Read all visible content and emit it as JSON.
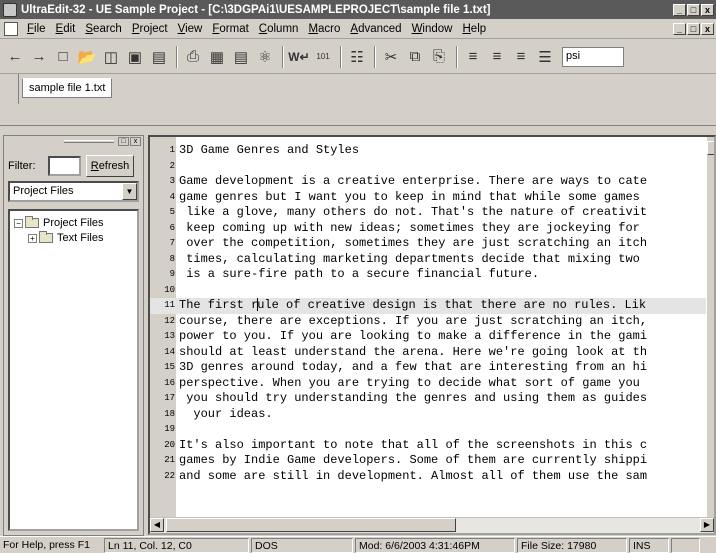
{
  "window": {
    "title": "UltraEdit-32 - UE Sample Project - [C:\\3DGPAi1\\UESAMPLEPROJECT\\sample file 1.txt]",
    "min_label": "_",
    "max_label": "□",
    "close_label": "x"
  },
  "menu": {
    "items": [
      "File",
      "Edit",
      "Search",
      "Project",
      "View",
      "Format",
      "Column",
      "Macro",
      "Advanced",
      "Window",
      "Help"
    ]
  },
  "toolbar": {
    "icons": [
      "back-arrow-icon",
      "forward-arrow-icon",
      "new-file-icon",
      "open-folder-icon",
      "open-file-icon",
      "save-icon",
      "save-all-icon",
      "print-icon",
      "print-preview-icon",
      "print-setup-icon",
      "find-icon",
      "word-wrap-icon",
      "hex-edit-icon",
      "column-mode-icon",
      "cut-icon",
      "copy-icon",
      "paste-icon",
      "align-left-icon",
      "align-center-icon",
      "align-right-icon",
      "justify-icon"
    ],
    "combo_value": "psi"
  },
  "tabs": [
    {
      "label": "sample file 1.txt"
    }
  ],
  "panel": {
    "filter_label": "Filter:",
    "filter_value": "",
    "refresh_label": "Refresh",
    "project_select": "Project Files",
    "tree": [
      {
        "label": "Project Files",
        "toggle": "−"
      },
      {
        "label": "Text Files",
        "toggle": "+"
      }
    ]
  },
  "editor": {
    "lines": [
      {
        "n": "1",
        "text": "3D Game Genres and Styles"
      },
      {
        "n": "2",
        "text": ""
      },
      {
        "n": "3",
        "text": "Game development is a creative enterprise. There are ways to cate"
      },
      {
        "n": "4",
        "text": "game genres but I want you to keep in mind that while some games"
      },
      {
        "n": "5",
        "text": " like a glove, many others do not. That's the nature of creativit"
      },
      {
        "n": "6",
        "text": " keep coming up with new ideas; sometimes they are jockeying for"
      },
      {
        "n": "7",
        "text": " over the competition, sometimes they are just scratching an itch"
      },
      {
        "n": "8",
        "text": " times, calculating marketing departments decide that mixing two"
      },
      {
        "n": "9",
        "text": " is a sure-fire path to a secure financial future."
      },
      {
        "n": "10",
        "text": ""
      },
      {
        "n": "11",
        "text_before": "The first r",
        "text_after": "ule of creative design is that there are no rules. Lik",
        "highlight": true
      },
      {
        "n": "12",
        "text": "course, there are exceptions. If you are just scratching an itch,"
      },
      {
        "n": "13",
        "text": "power to you. If you are looking to make a difference in the gami"
      },
      {
        "n": "14",
        "text": "should at least understand the arena. Here we're going look at th"
      },
      {
        "n": "15",
        "text": "3D genres around today, and a few that are interesting from an hi"
      },
      {
        "n": "16",
        "text": "perspective. When you are trying to decide what sort of game you"
      },
      {
        "n": "17",
        "text": " you should try understanding the genres and using them as guides"
      },
      {
        "n": "18",
        "text": "  your ideas."
      },
      {
        "n": "19",
        "text": ""
      },
      {
        "n": "20",
        "text": "It's also important to note that all of the screenshots in this c"
      },
      {
        "n": "21",
        "text": "games by Indie Game developers. Some of them are currently shippi"
      },
      {
        "n": "22",
        "text": "and some are still in development. Almost all of them use the sam"
      }
    ]
  },
  "status": {
    "help": "For Help, press F1",
    "position": "Ln 11, Col. 12, C0",
    "format": "DOS",
    "modified": "Mod: 6/6/2003 4:31:46PM",
    "file_size": "File Size: 17980",
    "mode": "INS"
  }
}
